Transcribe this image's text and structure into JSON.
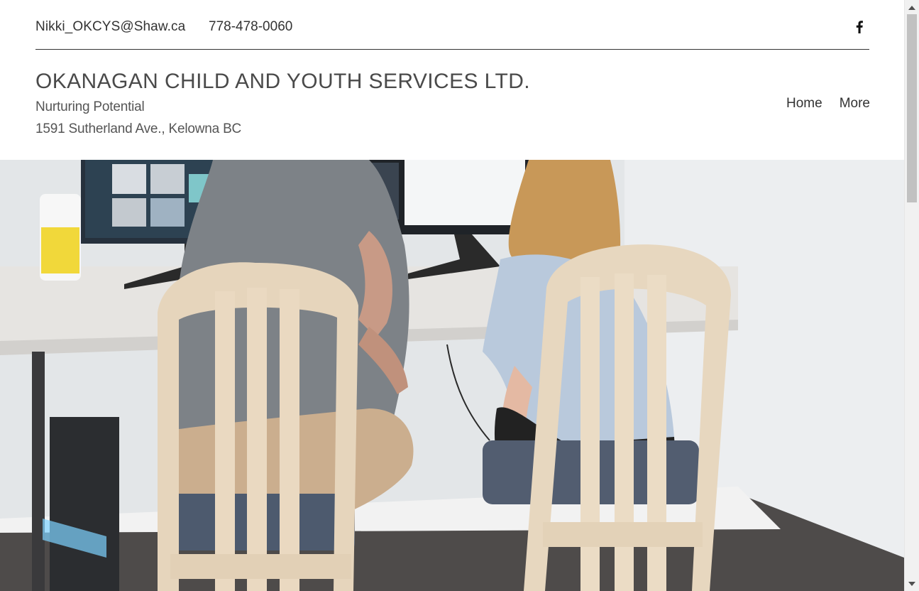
{
  "topbar": {
    "email": "Nikki_OKCYS@Shaw.ca",
    "phone": "778-478-0060",
    "social_icon": "facebook-icon"
  },
  "header": {
    "title": "OKANAGAN CHILD AND YOUTH SERVICES LTD.",
    "tagline": "Nurturing Potential",
    "address": "1591 Sutherland Ave., Kelowna BC"
  },
  "nav": {
    "items": [
      {
        "label": "Home"
      },
      {
        "label": "More"
      }
    ]
  },
  "colors": {
    "text_dark": "#333333",
    "title": "#4a4a4a",
    "background": "#ffffff"
  }
}
